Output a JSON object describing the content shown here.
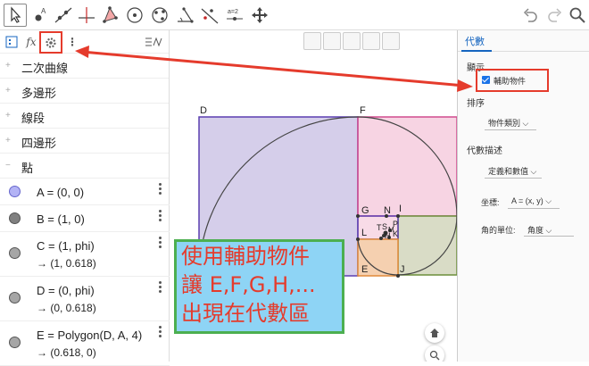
{
  "toolbar": {
    "tools": [
      "move-tool-icon",
      "point-tool-icon",
      "line-tool-icon",
      "perpendicular-tool-icon",
      "polygon-tool-icon",
      "circle-tool-icon",
      "conic-tool-icon",
      "angle-tool-icon",
      "reflect-tool-icon",
      "slider-tool-icon",
      "move-view-tool-icon"
    ],
    "slider_tool_label": "a=2",
    "right": [
      "undo-icon",
      "redo-icon",
      "search-icon"
    ]
  },
  "algebra": {
    "categories": [
      {
        "sign": "+",
        "label": "二次曲線"
      },
      {
        "sign": "+",
        "label": "多邊形"
      },
      {
        "sign": "+",
        "label": "線段"
      },
      {
        "sign": "+",
        "label": "四邊形"
      },
      {
        "sign": "−",
        "label": "點"
      }
    ],
    "items": [
      {
        "text": "A = (0, 0)",
        "sub": "",
        "color": "#b3b3f5"
      },
      {
        "text": "B = (1, 0)",
        "sub": "",
        "color": "#808080"
      },
      {
        "text": "C = (1, phi)",
        "sub": "→ (1, 0.618)",
        "color": "#a6a6a6"
      },
      {
        "text": "D = (0, phi)",
        "sub": "→ (0, 0.618)",
        "color": "#a6a6a6"
      },
      {
        "text": "E = Polygon(D, A, 4)",
        "sub": "→ (0.618, 0)",
        "color": "#a6a6a6"
      }
    ]
  },
  "graphics": {
    "labels": {
      "D": "D",
      "F": "F",
      "G": "G",
      "N": "N",
      "I": "I",
      "L": "L",
      "E": "E",
      "J": "J",
      "S": "S",
      "P": "P",
      "K": "K",
      "H": "H",
      "T": "T",
      "M": "M"
    }
  },
  "props": {
    "tab": "代數",
    "display_header": "顯示",
    "aux_checkbox_label": "輔助物件",
    "sort_header": "排序",
    "sort_value": "物件類別",
    "desc_header": "代數描述",
    "desc_value": "定義和數值",
    "coord_label": "坐標:",
    "coord_value": "A = (x, y)",
    "angle_label": "角的單位:",
    "angle_value": "角度"
  },
  "callout": {
    "line1": "使用輔助物件",
    "line2": "讓 E,F,G,H,...",
    "line3": "出現在代數區"
  },
  "colors": {
    "accent": "#1565c0",
    "highlight_red": "#e53b2c",
    "callout_bg": "#8ed4f5",
    "callout_border": "#4caf50"
  }
}
